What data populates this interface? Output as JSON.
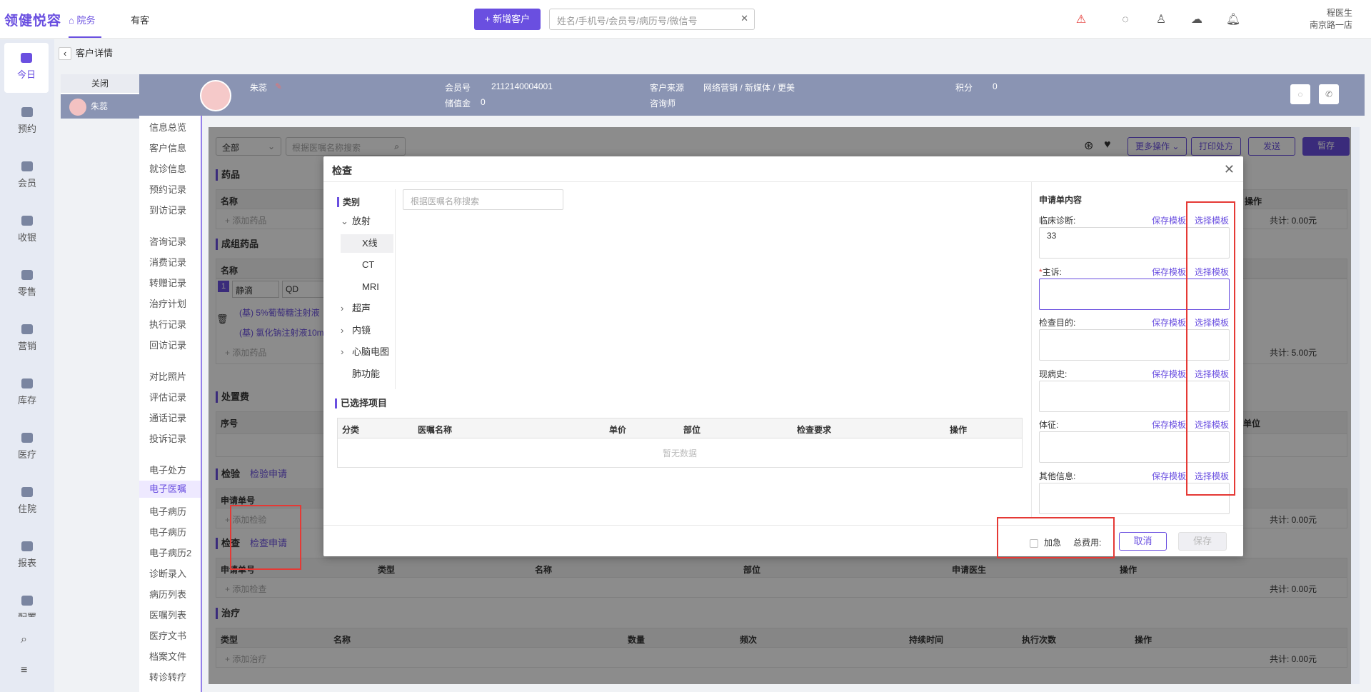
{
  "app": {
    "logo": "领健悦容"
  },
  "topnav": {
    "tabs": [
      "院务",
      "有客"
    ],
    "add_customer": "+ 新增客户",
    "search_placeholder": "姓名/手机号/会员号/病历号/微信号"
  },
  "user": {
    "name": "程医生",
    "clinic": "南京路一店"
  },
  "sidebar": {
    "items": [
      "今日",
      "预约",
      "会员",
      "收银",
      "零售",
      "营销",
      "库存",
      "医疗",
      "住院",
      "报表",
      "配置"
    ]
  },
  "breadcrumb": {
    "label": "客户详情"
  },
  "customer_tab": {
    "close": "关闭",
    "name": "朱蕊"
  },
  "header": {
    "name": "朱蕊",
    "member_no_label": "会员号",
    "member_no": "2112140004001",
    "balance_label": "储值金",
    "balance": "0",
    "source_label": "客户来源",
    "source": "网络营销 / 新媒体 / 更美",
    "consultant_label": "咨询师",
    "points_label": "积分",
    "points": "0"
  },
  "leftmenu": {
    "items": [
      "信息总览",
      "客户信息",
      "就诊信息",
      "预约记录",
      "到访记录",
      "咨询记录",
      "消费记录",
      "转赠记录",
      "治疗计划",
      "执行记录",
      "回访记录",
      "对比照片",
      "评估记录",
      "通话记录",
      "投诉记录",
      "电子处方",
      "电子医嘱",
      "电子病历",
      "电子病历",
      "电子病历2",
      "诊断录入",
      "病历列表",
      "医嘱列表",
      "医疗文书",
      "档案文件",
      "转诊转疗"
    ],
    "active": "电子医嘱"
  },
  "toolbar": {
    "filter": "全部",
    "search_placeholder": "根据医嘱名称搜索",
    "more": "更多操作",
    "print": "打印处方",
    "send": "发送",
    "save_draft": "暂存"
  },
  "bg": {
    "drug_title": "药品",
    "col_name": "名称",
    "add_drug": "+ 添加药品",
    "total1": "共计: 0.00元",
    "col_op": "操作",
    "group_title": "成组药品",
    "route": "静滴",
    "freq": "QD",
    "drug1": "(基) 5%葡萄糖注射液",
    "drug2": "(基) 氯化钠注射液10m",
    "total2": "共计: 5.00元",
    "fee_title": "处置费",
    "col_seq": "序号",
    "col_unit": "单位",
    "lab_title": "检验",
    "lab_apply": "检验申请",
    "col_apply_no": "申请单号",
    "add_lab": "+ 添加检验",
    "total3": "共计: 0.00元",
    "exam_title": "检查",
    "exam_apply": "检查申请",
    "exam_cols": [
      "申请单号",
      "类型",
      "名称",
      "部位",
      "申请医生",
      "操作"
    ],
    "add_exam": "+ 添加检查",
    "total4": "共计: 0.00元",
    "treat_title": "治疗",
    "treat_cols": [
      "类型",
      "名称",
      "数量",
      "频次",
      "持续时间",
      "执行次数",
      "操作"
    ],
    "add_treat": "+ 添加治疗",
    "total5": "共计: 0.00元"
  },
  "modal": {
    "title": "检查",
    "category_label": "类别",
    "tree": [
      {
        "label": "放射",
        "expanded": true
      },
      {
        "label": "X线",
        "child": true,
        "selected": true
      },
      {
        "label": "CT",
        "child": true
      },
      {
        "label": "MRI",
        "child": true
      },
      {
        "label": "超声"
      },
      {
        "label": "内镜"
      },
      {
        "label": "心脑电图"
      },
      {
        "label": "肺功能"
      }
    ],
    "search_placeholder": "根据医嘱名称搜索",
    "selected_title": "已选择项目",
    "selected_cols": [
      "分类",
      "医嘱名称",
      "单价",
      "部位",
      "检查要求",
      "操作"
    ],
    "empty": "暂无数据",
    "form_title": "申请单内容",
    "save_tpl": "保存模板",
    "select_tpl": "选择模板",
    "fields": [
      {
        "label": "临床诊断:",
        "value": "33",
        "required": false
      },
      {
        "label": "主诉:",
        "value": "",
        "required": true
      },
      {
        "label": "检查目的:",
        "value": "",
        "required": false
      },
      {
        "label": "现病史:",
        "value": "",
        "required": false
      },
      {
        "label": "体征:",
        "value": "",
        "required": false
      },
      {
        "label": "其他信息:",
        "value": "",
        "required": false
      }
    ],
    "urgent": "加急",
    "total_fee": "总费用:",
    "cancel": "取消",
    "save": "保存"
  }
}
